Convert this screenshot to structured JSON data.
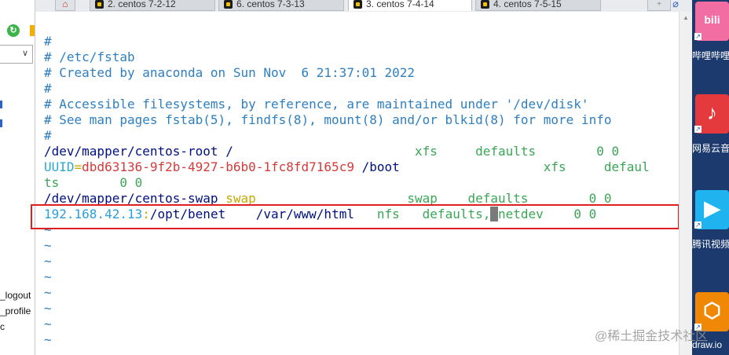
{
  "tabs": [
    {
      "label": "2. centos 7-2-12",
      "active": false
    },
    {
      "label": "6. centos 7-3-13",
      "active": false
    },
    {
      "label": "3. centos 7-4-14",
      "active": true
    },
    {
      "label": "4. centos 7-5-15",
      "active": false
    }
  ],
  "left_panel": {
    "file_items": [
      "_logout",
      "_profile",
      "c"
    ]
  },
  "terminal": {
    "lines": [
      [
        {
          "t": "#",
          "c": "cm"
        }
      ],
      [
        {
          "t": "# /etc/fstab",
          "c": "cm"
        }
      ],
      [
        {
          "t": "# Created by anaconda on Sun Nov  6 21:37:01 2022",
          "c": "cm"
        }
      ],
      [
        {
          "t": "#",
          "c": "cm"
        }
      ],
      [
        {
          "t": "# Accessible filesystems, by reference, are maintained under '/dev/disk'",
          "c": "cm"
        }
      ],
      [
        {
          "t": "# See man pages fstab(5), findfs(8), mount(8) and/or blkid(8) for more info",
          "c": "cm"
        }
      ],
      [
        {
          "t": "#",
          "c": "cm"
        }
      ],
      [
        {
          "t": "/dev/mapper/centos-root /",
          "c": "pl"
        },
        {
          "t": "                        xfs     defaults        0 0",
          "c": "gr"
        }
      ],
      [
        {
          "t": "UUID",
          "c": "cy"
        },
        {
          "t": "=",
          "c": "ye"
        },
        {
          "t": "dbd63136-9f2b-4927-b6b0-1fc8fd7165c9",
          "c": "rd"
        },
        {
          "t": " /boot",
          "c": "pl"
        },
        {
          "t": "                   xfs     defaul",
          "c": "gr"
        }
      ],
      [
        {
          "t": "ts",
          "c": "gr"
        },
        {
          "t": "        0 0",
          "c": "gr"
        }
      ],
      [
        {
          "t": "/dev/mapper/centos-swap ",
          "c": "pl"
        },
        {
          "t": "swap",
          "c": "ye"
        },
        {
          "t": "                    swap    defaults        0 0",
          "c": "gr"
        }
      ],
      [
        {
          "t": "192.168.42.13",
          "c": "tl"
        },
        {
          "t": ":",
          "c": "ye"
        },
        {
          "t": "/opt/benet    /var/www/html",
          "c": "pl"
        },
        {
          "t": "   nfs   defaults,",
          "c": "gr"
        },
        {
          "t": "_",
          "c": "cursor"
        },
        {
          "t": "netdev    0 0",
          "c": "gr"
        }
      ],
      [
        {
          "t": "~",
          "c": "cm"
        }
      ],
      [
        {
          "t": "~",
          "c": "cm"
        }
      ],
      [
        {
          "t": "~",
          "c": "cm"
        }
      ],
      [
        {
          "t": "~",
          "c": "cm"
        }
      ],
      [
        {
          "t": "~",
          "c": "cm"
        }
      ],
      [
        {
          "t": "~",
          "c": "cm"
        }
      ],
      [
        {
          "t": "~",
          "c": "cm"
        }
      ],
      [
        {
          "t": "~",
          "c": "cm"
        }
      ]
    ]
  },
  "taskbar": {
    "apps": [
      {
        "name": "bilibili",
        "icon_text": "bili",
        "label": "哔哩哔哩",
        "color": "#f26da2"
      },
      {
        "name": "netease-music",
        "icon_text": "♪",
        "label": "网易云音",
        "color": "#e43a3d"
      },
      {
        "name": "tencent-video",
        "icon_text": "▶",
        "label": "腾讯视频",
        "color": "#1fb4f0"
      },
      {
        "name": "drawio",
        "icon_text": "⬡",
        "label": "draw.io",
        "color": "#f08705"
      }
    ]
  },
  "watermark": "@稀土掘金技术社区",
  "colors": {
    "comment": "#2f7fc0",
    "path": "#001080",
    "value": "#3aa655",
    "uuid": "#d53a3a",
    "highlight_box": "#e02020"
  }
}
